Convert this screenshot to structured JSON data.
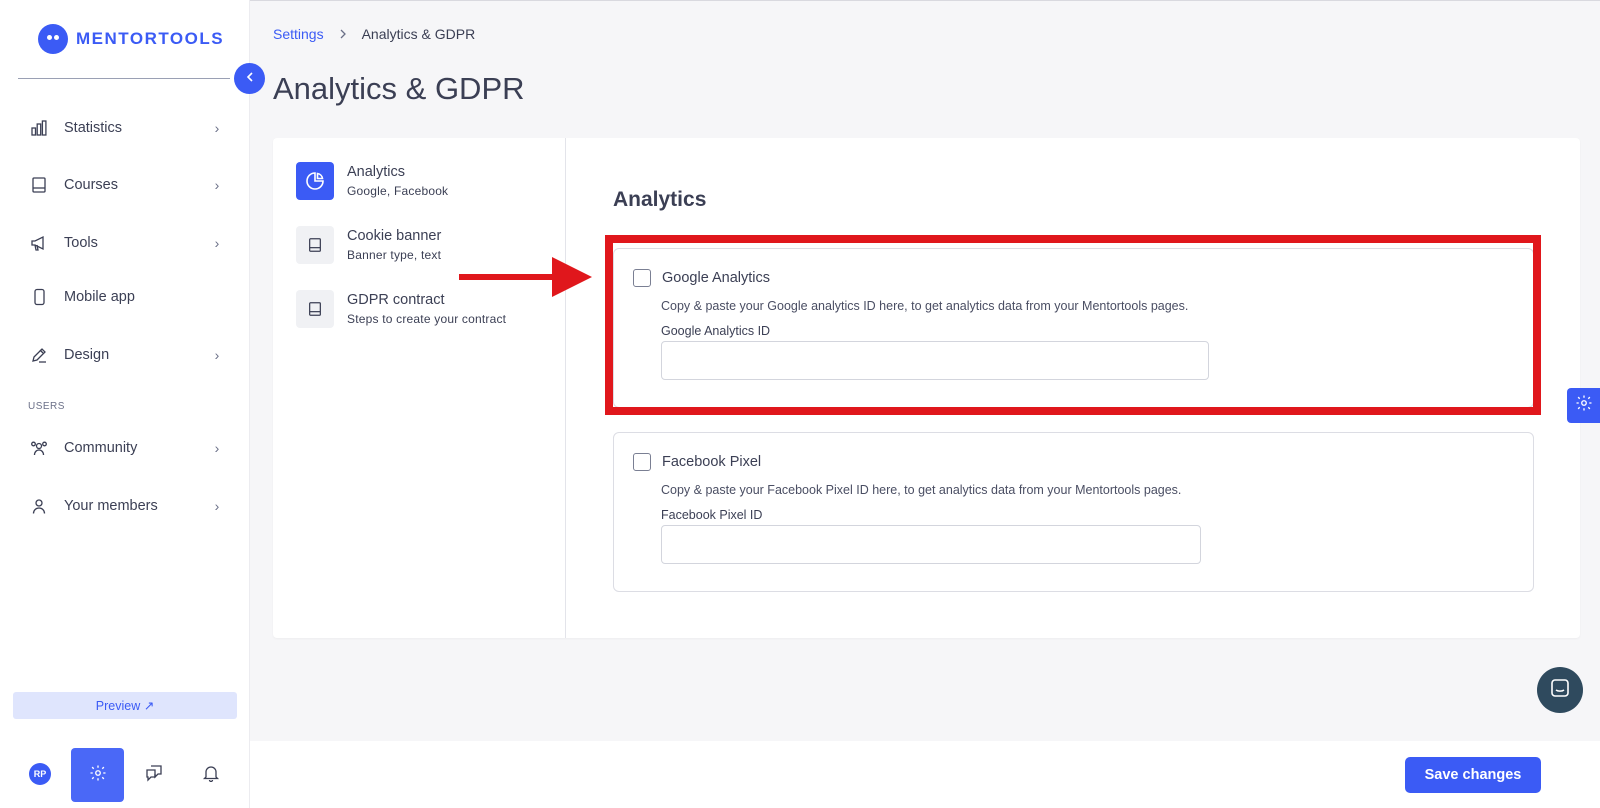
{
  "brand": {
    "name": "MENTORTOOLS",
    "accent": "#3b5bf5"
  },
  "sidebar": {
    "items": [
      {
        "label": "Statistics",
        "icon": "bar-chart-icon",
        "has_chevron": true
      },
      {
        "label": "Courses",
        "icon": "book-icon",
        "has_chevron": true
      },
      {
        "label": "Tools",
        "icon": "megaphone-icon",
        "has_chevron": true
      },
      {
        "label": "Mobile app",
        "icon": "phone-icon",
        "has_chevron": false
      },
      {
        "label": "Design",
        "icon": "pencil-icon",
        "has_chevron": true
      }
    ],
    "section_users": "USERS",
    "user_items": [
      {
        "label": "Community",
        "icon": "people-icon",
        "has_chevron": true
      },
      {
        "label": "Your members",
        "icon": "user-icon",
        "has_chevron": true
      }
    ],
    "preview_label": "Preview ↗",
    "avatar_initials": "RP"
  },
  "breadcrumb": {
    "parent": "Settings",
    "current": "Analytics & GDPR"
  },
  "page_title": "Analytics & GDPR",
  "subnav": [
    {
      "title": "Analytics",
      "desc": "Google, Facebook",
      "active": true
    },
    {
      "title": "Cookie banner",
      "desc": "Banner type, text",
      "active": false
    },
    {
      "title": "GDPR contract",
      "desc": "Steps to create your contract",
      "active": false
    }
  ],
  "content": {
    "title": "Analytics",
    "google": {
      "title": "Google Analytics",
      "desc": "Copy & paste your Google analytics ID here, to get analytics data from your Mentortools pages.",
      "field_label": "Google Analytics ID",
      "value": "",
      "checked": false
    },
    "facebook": {
      "title": "Facebook Pixel",
      "desc": "Copy & paste your Facebook Pixel ID here, to get analytics data from your Mentortools pages.",
      "field_label": "Facebook Pixel ID",
      "value": "",
      "checked": false
    }
  },
  "footer": {
    "save_label": "Save changes"
  },
  "annotation_color": "#e0171c"
}
